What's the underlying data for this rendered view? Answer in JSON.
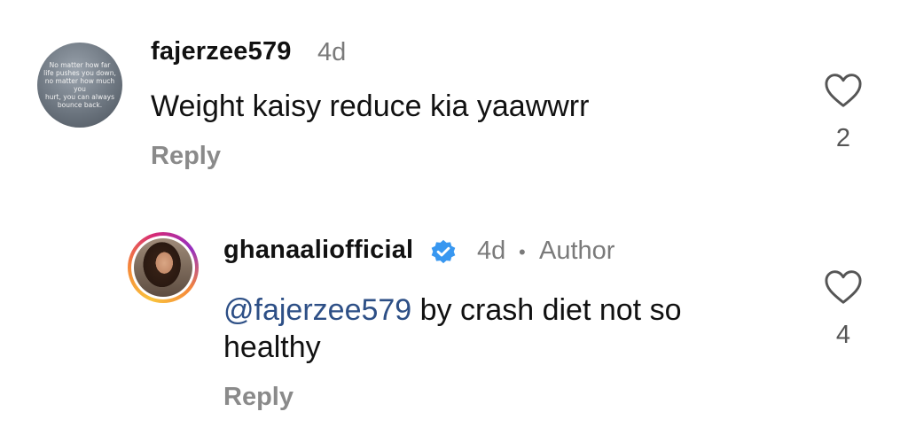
{
  "comments": [
    {
      "username": "fajerzee579",
      "time": "4d",
      "text": "Weight kaisy reduce kia yaawwrr",
      "reply_label": "Reply",
      "like_count": "2",
      "avatar_text": "No matter how far\nlife pushes you down,\nno matter how much you\nhurt, you can always\nbounce back."
    }
  ],
  "reply_comment": {
    "username": "ghanaaliofficial",
    "time": "4d",
    "separator": "•",
    "author_label": "Author",
    "mention": "@fajerzee579",
    "text_line1": " by crash diet not so",
    "text_line2": "healthy",
    "reply_label": "Reply",
    "like_count": "4"
  },
  "colors": {
    "mention": "#2d4f86",
    "verified_badge": "#3897f0",
    "secondary_text": "#7a7a7a"
  }
}
